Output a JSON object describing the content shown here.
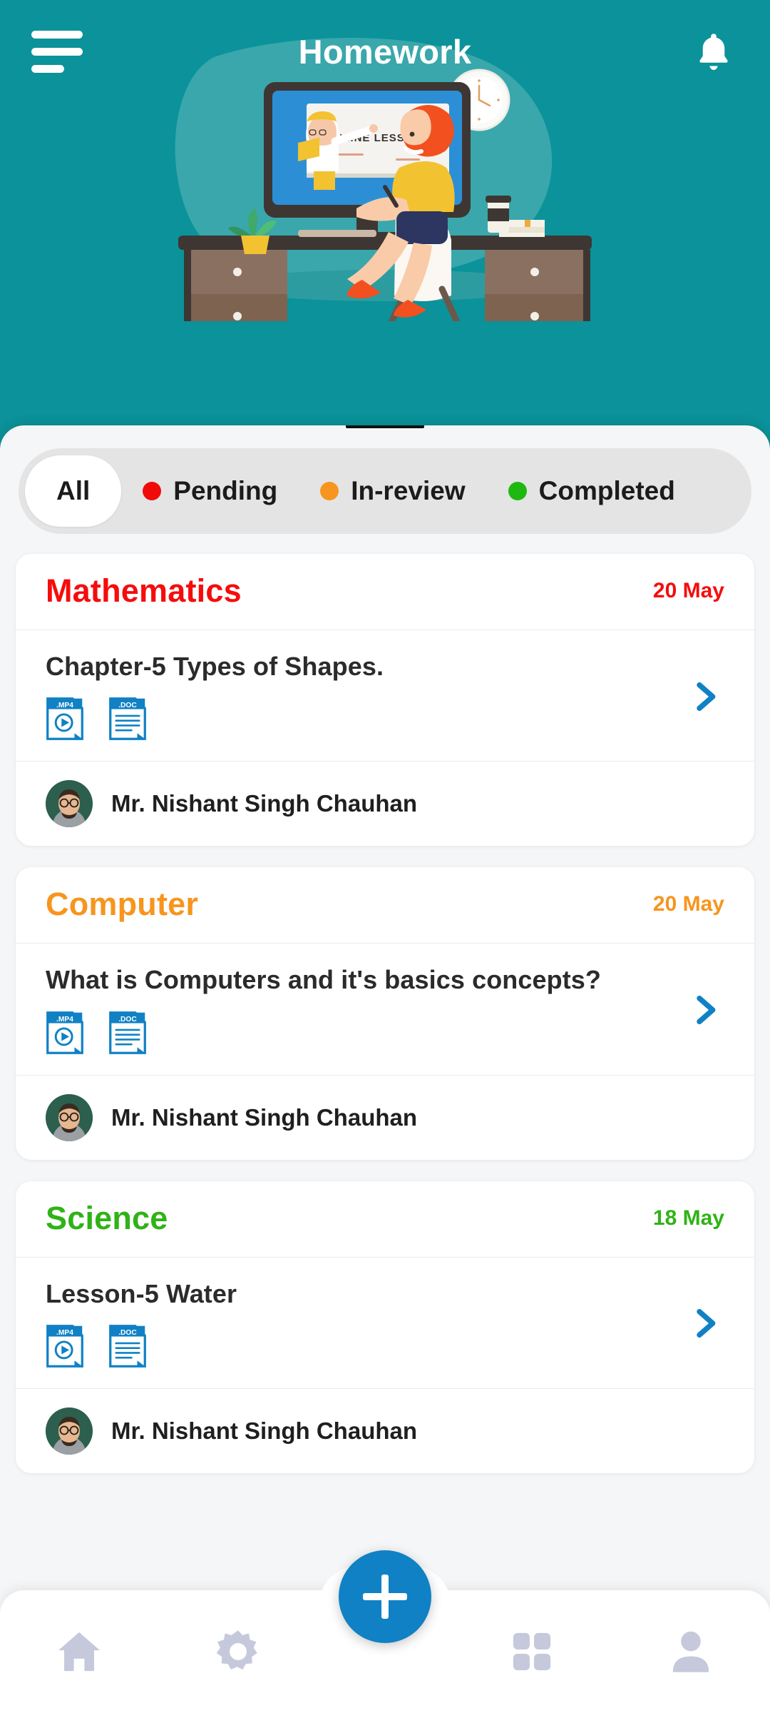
{
  "header": {
    "title": "Homework",
    "menu_icon": "hamburger-menu-icon",
    "bell_icon": "notification-bell-icon",
    "background_color": "#0B929A"
  },
  "illustration": {
    "name": "student-online-learning-illustration",
    "whiteboard_text": "ONLINE LESSONS"
  },
  "filters": {
    "items": [
      {
        "label": "All",
        "dot_color": "",
        "active": true
      },
      {
        "label": "Pending",
        "dot_color": "#F00B0B",
        "active": false
      },
      {
        "label": "In-review",
        "dot_color": "#F7951E",
        "active": false
      },
      {
        "label": "Completed",
        "dot_color": "#1DB911",
        "active": false
      }
    ]
  },
  "cards": [
    {
      "subject": "Mathematics",
      "subject_color": "#F60C0C",
      "due_date": "20 May",
      "homework_title": "Chapter-5 Types of Shapes.",
      "attachments": [
        {
          "label": ".MP4",
          "icon": "video-file-icon"
        },
        {
          "label": ".DOC",
          "icon": "document-file-icon"
        }
      ],
      "chevron_icon": "chevron-right-icon",
      "teacher": "Mr. Nishant Singh Chauhan"
    },
    {
      "subject": "Computer",
      "subject_color": "#F7951E",
      "due_date": "20 May",
      "homework_title": "What is Computers and it's basics concepts?",
      "attachments": [
        {
          "label": ".MP4",
          "icon": "video-file-icon"
        },
        {
          "label": ".DOC",
          "icon": "document-file-icon"
        }
      ],
      "chevron_icon": "chevron-right-icon",
      "teacher": "Mr. Nishant Singh Chauhan"
    },
    {
      "subject": "Science",
      "subject_color": "#2FB316",
      "due_date": "18 May",
      "homework_title": "Lesson-5 Water",
      "attachments": [
        {
          "label": ".MP4",
          "icon": "video-file-icon"
        },
        {
          "label": ".DOC",
          "icon": "document-file-icon"
        }
      ],
      "chevron_icon": "chevron-right-icon",
      "teacher": "Mr. Nishant Singh Chauhan"
    }
  ],
  "bottom_nav": {
    "items": [
      {
        "icon": "home-icon",
        "name": "nav-home"
      },
      {
        "icon": "gear-icon",
        "name": "nav-settings"
      },
      {
        "icon": "grid-icon",
        "name": "nav-dashboard"
      },
      {
        "icon": "person-icon",
        "name": "nav-profile"
      }
    ],
    "fab": {
      "icon": "plus-icon",
      "color": "#1081C4"
    },
    "icon_color": "#C5C9DB"
  },
  "colors": {
    "teal": "#0B929A",
    "sheet": "#F5F6F7",
    "blue": "#1081C4",
    "chip_track": "#E4E4E4"
  }
}
